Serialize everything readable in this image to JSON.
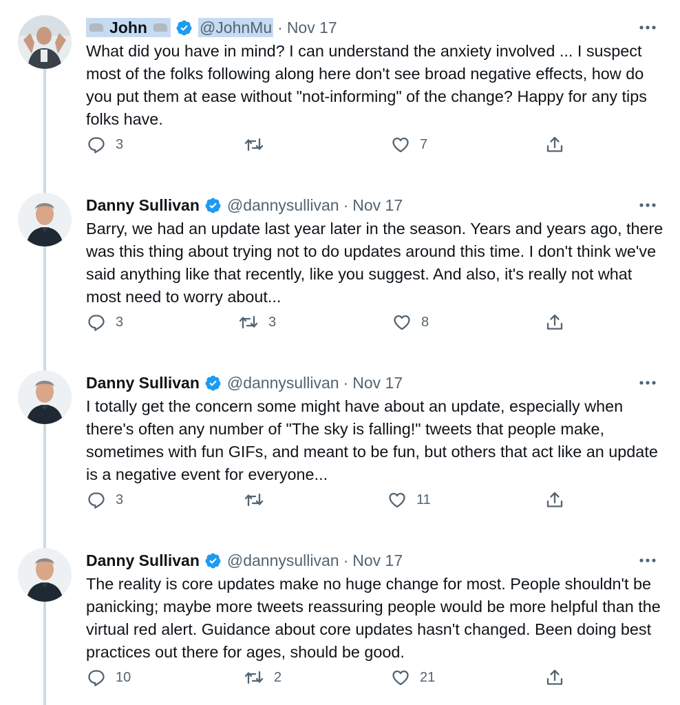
{
  "tweets": [
    {
      "name": "John",
      "handle": "@JohnMu",
      "time": "Nov 17",
      "text": "What did you have in mind? I can understand the anxiety involved ... I suspect most of the folks following along here don't see broad negative effects, how do you put them at ease without \"not-informing\" of the change? Happy for any tips folks have.",
      "replies": "3",
      "retweets": "",
      "likes": "7"
    },
    {
      "name": "Danny Sullivan",
      "handle": "@dannysullivan",
      "time": "Nov 17",
      "text": "Barry, we had an update last year later in the season. Years and years ago, there was this thing about trying not to do updates around this time. I don't think we've said anything like that recently, like you suggest. And also, it's really not what most need to worry about...",
      "replies": "3",
      "retweets": "3",
      "likes": "8"
    },
    {
      "name": "Danny Sullivan",
      "handle": "@dannysullivan",
      "time": "Nov 17",
      "text": "I totally get the concern some might have about an update, especially when there's often any number of \"The sky is falling!\" tweets that people make, sometimes with fun GIFs, and meant to be fun, but others that act like an update is a negative event for everyone...",
      "replies": "3",
      "retweets": "",
      "likes": "11"
    },
    {
      "name": "Danny Sullivan",
      "handle": "@dannysullivan",
      "time": "Nov 17",
      "text": "The reality is core updates make no huge change for most. People shouldn't be panicking; maybe more tweets reassuring people would be more helpful than the virtual red alert. Guidance about core updates hasn't changed. Been doing best practices out there for ages, should be good.",
      "replies": "10",
      "retweets": "2",
      "likes": "21"
    }
  ],
  "icons": {
    "verified": "verified-badge-icon",
    "more": "more-options-icon",
    "reply": "reply-icon",
    "retweet": "retweet-icon",
    "like": "like-icon",
    "share": "share-icon"
  },
  "colors": {
    "text": "#0f1419",
    "secondary": "#536471",
    "verified": "#1d9bf0",
    "thread_line": "#cfd9de",
    "redaction_highlight": "#c6dbf2"
  }
}
